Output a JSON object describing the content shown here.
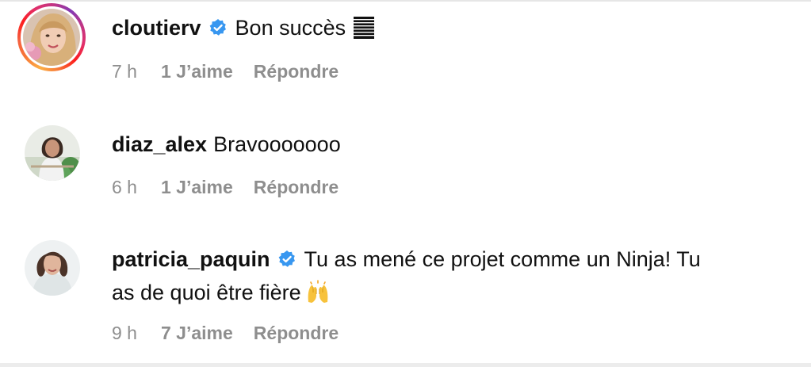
{
  "comments": [
    {
      "username": "cloutierv",
      "verified": true,
      "text": "Bon succès",
      "emoji": "flag-icon",
      "time": "7 h",
      "likes": "1 J’aime",
      "reply": "Répondre"
    },
    {
      "username": "diaz_alex",
      "verified": false,
      "text": "Bravooooooo",
      "time": "6 h",
      "likes": "1 J’aime",
      "reply": "Répondre"
    },
    {
      "username": "patricia_paquin",
      "verified": true,
      "text_line1": "Tu as mené ce projet comme un Ninja! Tu",
      "text_line2": "as de quoi être fière",
      "emoji": "raising-hands-icon",
      "time": "9 h",
      "likes": "7 J’aime",
      "reply": "Répondre"
    }
  ],
  "colors": {
    "verified_badge": "#3897f0",
    "meta_text": "#8e8e8e",
    "primary_text": "#111111"
  }
}
